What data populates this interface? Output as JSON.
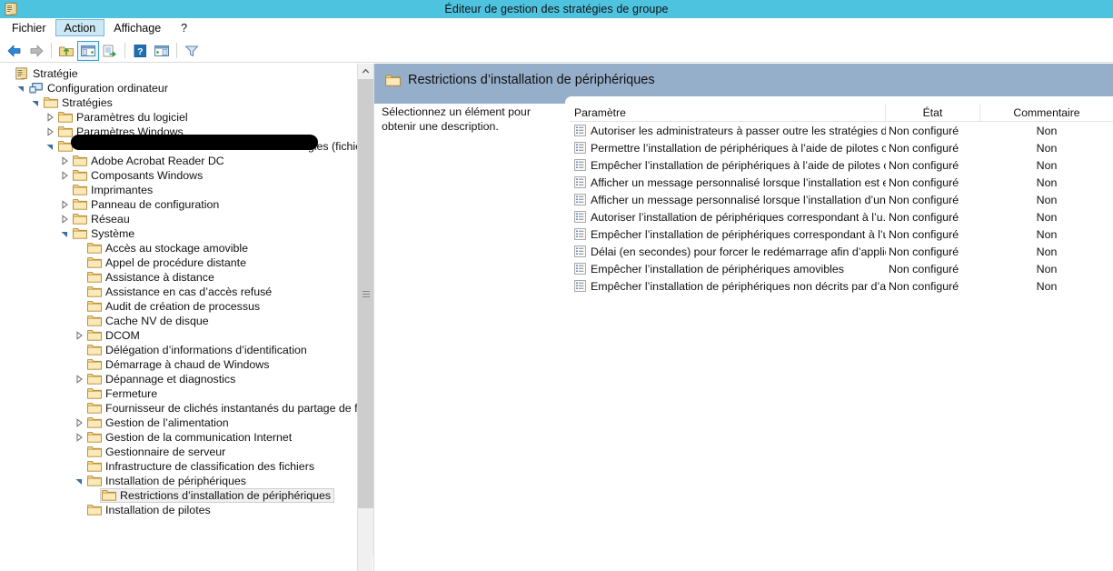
{
  "window": {
    "title": "Éditeur de gestion des stratégies de groupe",
    "icon": "policy-scroll-icon",
    "titlebar_color": "#4ec3e0"
  },
  "menubar": {
    "items": [
      {
        "label": "Fichier",
        "active": false
      },
      {
        "label": "Action",
        "active": true
      },
      {
        "label": "Affichage",
        "active": false
      },
      {
        "label": "?",
        "active": false
      }
    ]
  },
  "toolbar": {
    "buttons": [
      {
        "name": "back-arrow-icon",
        "pressed": false
      },
      {
        "name": "forward-arrow-icon",
        "pressed": false
      },
      {
        "name": "up-folder-icon",
        "pressed": false
      },
      {
        "name": "show-hide-tree-icon",
        "pressed": true
      },
      {
        "name": "export-list-icon",
        "pressed": false
      },
      {
        "name": "help-icon",
        "pressed": false
      },
      {
        "name": "show-action-pane-icon",
        "pressed": false
      },
      {
        "name": "filter-icon",
        "pressed": false
      }
    ]
  },
  "tree": {
    "redacted_root_prefix": "Stratégie",
    "nodes": [
      {
        "label": "Stratégie",
        "depth": 0,
        "expander": "none",
        "icon": "policy-scroll-icon",
        "selected": false,
        "redacted": true
      },
      {
        "label": "Configuration ordinateur",
        "depth": 1,
        "expander": "expanded",
        "icon": "computer-icon",
        "selected": false
      },
      {
        "label": "Stratégies",
        "depth": 2,
        "expander": "expanded",
        "icon": "folder-icon",
        "selected": false
      },
      {
        "label": "Paramètres du logiciel",
        "depth": 3,
        "expander": "collapsed",
        "icon": "folder-icon",
        "selected": false
      },
      {
        "label": "Paramètres Windows",
        "depth": 3,
        "expander": "collapsed",
        "icon": "folder-icon",
        "selected": false
      },
      {
        "label": "Modèles d’administration : définitions de stratégies (fichier",
        "depth": 3,
        "expander": "expanded",
        "icon": "folder-icon",
        "selected": false
      },
      {
        "label": "Adobe Acrobat Reader DC",
        "depth": 4,
        "expander": "collapsed",
        "icon": "folder-icon",
        "selected": false
      },
      {
        "label": "Composants Windows",
        "depth": 4,
        "expander": "collapsed",
        "icon": "folder-icon",
        "selected": false
      },
      {
        "label": "Imprimantes",
        "depth": 4,
        "expander": "none",
        "icon": "folder-icon",
        "selected": false
      },
      {
        "label": "Panneau de configuration",
        "depth": 4,
        "expander": "collapsed",
        "icon": "folder-icon",
        "selected": false
      },
      {
        "label": "Réseau",
        "depth": 4,
        "expander": "collapsed",
        "icon": "folder-icon",
        "selected": false
      },
      {
        "label": "Système",
        "depth": 4,
        "expander": "expanded",
        "icon": "folder-icon",
        "selected": false
      },
      {
        "label": "Accès au stockage amovible",
        "depth": 5,
        "expander": "none",
        "icon": "folder-icon",
        "selected": false
      },
      {
        "label": "Appel de procédure distante",
        "depth": 5,
        "expander": "none",
        "icon": "folder-icon",
        "selected": false
      },
      {
        "label": "Assistance à distance",
        "depth": 5,
        "expander": "none",
        "icon": "folder-icon",
        "selected": false
      },
      {
        "label": "Assistance en cas d’accès refusé",
        "depth": 5,
        "expander": "none",
        "icon": "folder-icon",
        "selected": false
      },
      {
        "label": "Audit de création de processus",
        "depth": 5,
        "expander": "none",
        "icon": "folder-icon",
        "selected": false
      },
      {
        "label": "Cache NV de disque",
        "depth": 5,
        "expander": "none",
        "icon": "folder-icon",
        "selected": false
      },
      {
        "label": "DCOM",
        "depth": 5,
        "expander": "collapsed",
        "icon": "folder-icon",
        "selected": false
      },
      {
        "label": "Délégation d’informations d’identification",
        "depth": 5,
        "expander": "none",
        "icon": "folder-icon",
        "selected": false
      },
      {
        "label": "Démarrage à chaud de Windows",
        "depth": 5,
        "expander": "none",
        "icon": "folder-icon",
        "selected": false
      },
      {
        "label": "Dépannage et diagnostics",
        "depth": 5,
        "expander": "collapsed",
        "icon": "folder-icon",
        "selected": false
      },
      {
        "label": "Fermeture",
        "depth": 5,
        "expander": "none",
        "icon": "folder-icon",
        "selected": false
      },
      {
        "label": "Fournisseur de clichés instantanés du partage de fic",
        "depth": 5,
        "expander": "none",
        "icon": "folder-icon",
        "selected": false
      },
      {
        "label": "Gestion de l’alimentation",
        "depth": 5,
        "expander": "collapsed",
        "icon": "folder-icon",
        "selected": false
      },
      {
        "label": "Gestion de la communication Internet",
        "depth": 5,
        "expander": "collapsed",
        "icon": "folder-icon",
        "selected": false
      },
      {
        "label": "Gestionnaire de serveur",
        "depth": 5,
        "expander": "none",
        "icon": "folder-icon",
        "selected": false
      },
      {
        "label": "Infrastructure de classification des fichiers",
        "depth": 5,
        "expander": "none",
        "icon": "folder-icon",
        "selected": false
      },
      {
        "label": "Installation de périphériques",
        "depth": 5,
        "expander": "expanded",
        "icon": "folder-icon",
        "selected": false
      },
      {
        "label": "Restrictions d’installation de périphériques",
        "depth": 6,
        "expander": "none",
        "icon": "folder-icon",
        "selected": true
      },
      {
        "label": "Installation de pilotes",
        "depth": 5,
        "expander": "none",
        "icon": "folder-icon",
        "selected": false
      }
    ]
  },
  "details": {
    "header_title": "Restrictions d’installation de périphériques",
    "header_icon": "folder-icon",
    "header_color": "#95afca",
    "description": "Sélectionnez un élément pour obtenir une description.",
    "columns": [
      "Paramètre",
      "État",
      "Commentaire"
    ],
    "rows": [
      {
        "setting": "Autoriser les administrateurs à passer outre les stratégies de ...",
        "state": "Non configuré",
        "comment": "Non"
      },
      {
        "setting": "Permettre l’installation de périphériques à l’aide de pilotes c...",
        "state": "Non configuré",
        "comment": "Non"
      },
      {
        "setting": "Empêcher l’installation de périphériques à l’aide de pilotes c...",
        "state": "Non configuré",
        "comment": "Non"
      },
      {
        "setting": "Afficher un message personnalisé lorsque l’installation est e...",
        "state": "Non configuré",
        "comment": "Non"
      },
      {
        "setting": "Afficher un message personnalisé lorsque l’installation d’un ...",
        "state": "Non configuré",
        "comment": "Non"
      },
      {
        "setting": "Autoriser l’installation de périphériques correspondant à l’u...",
        "state": "Non configuré",
        "comment": "Non"
      },
      {
        "setting": "Empêcher l’installation de périphériques correspondant à l’u...",
        "state": "Non configuré",
        "comment": "Non"
      },
      {
        "setting": "Délai (en secondes) pour forcer le redémarrage afin d’appliq...",
        "state": "Non configuré",
        "comment": "Non"
      },
      {
        "setting": "Empêcher l’installation de périphériques amovibles",
        "state": "Non configuré",
        "comment": "Non"
      },
      {
        "setting": "Empêcher l’installation de périphériques non décrits par d’a...",
        "state": "Non configuré",
        "comment": "Non"
      }
    ]
  },
  "scrollbar": {
    "up_arrow": "chevron-up-icon",
    "grip": "scrollbar-grip"
  }
}
